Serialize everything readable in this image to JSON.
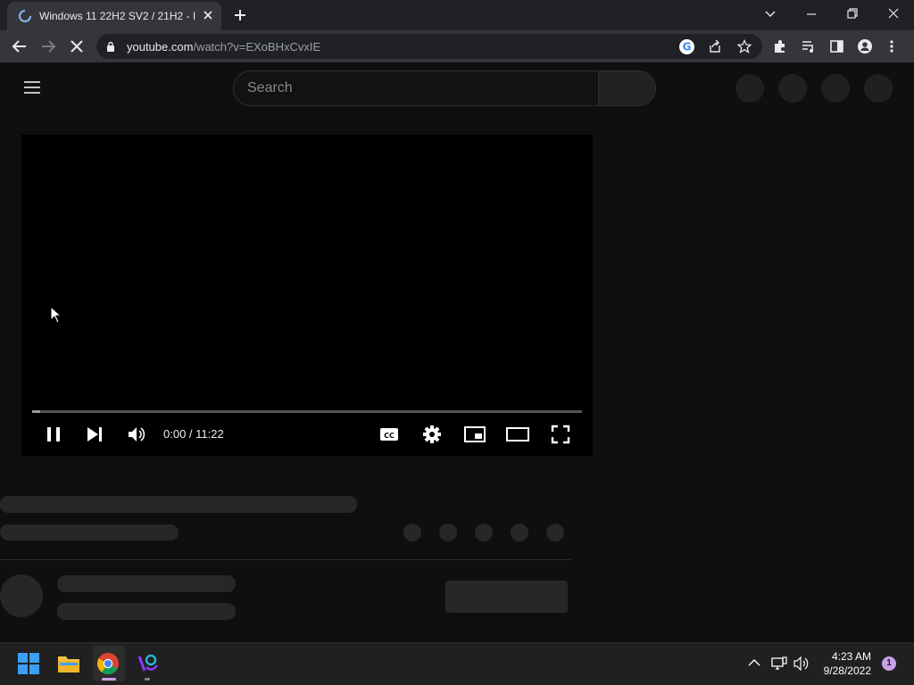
{
  "browser": {
    "tab_title": "Windows 11 22H2 SV2 / 21H2 - I",
    "url_domain": "youtube.com",
    "url_path": "/watch?v=EXoBHxCvxIE"
  },
  "youtube": {
    "search_placeholder": "Search"
  },
  "player": {
    "time_display": "0:00 / 11:22",
    "progress_fraction": 0.015
  },
  "taskbar": {
    "time": "4:23 AM",
    "date": "9/28/2022",
    "notification_count": "1"
  },
  "icons": {
    "tab": "loading-spinner-icon",
    "new_tab": "plus-icon",
    "back": "arrow-left-icon",
    "forward": "arrow-right-icon",
    "reload": "stop-loading-icon",
    "lock": "lock-icon",
    "google": "google-icon",
    "share": "share-icon",
    "bookmark": "star-icon",
    "extensions": "puzzle-icon",
    "media": "media-queue-icon",
    "side_panel": "side-panel-icon",
    "profile": "profile-icon",
    "menu": "kebab-menu-icon"
  },
  "colors": {
    "chrome_dark": "#202124",
    "chrome_toolbar": "#35363a",
    "page_bg": "#0f0f0f",
    "skeleton": "#272727",
    "taskbar": "#202020",
    "notification_badge": "#c8a2e8"
  }
}
